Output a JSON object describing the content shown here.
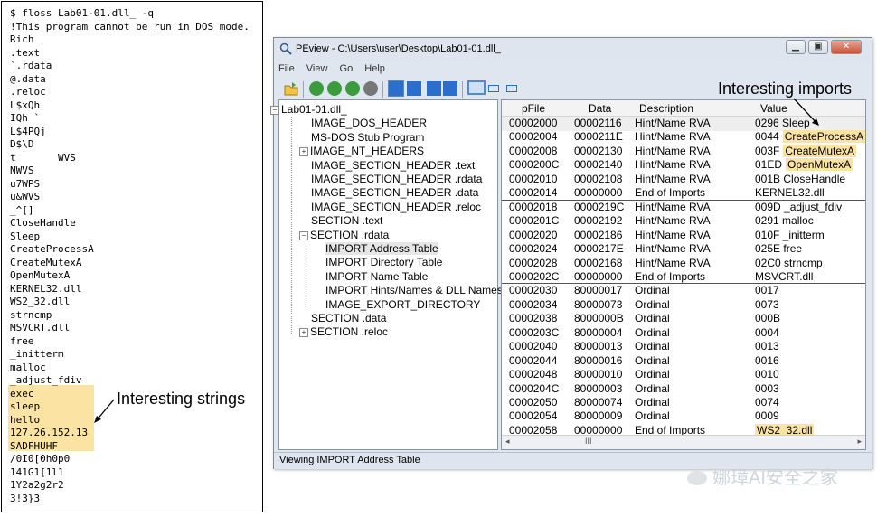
{
  "terminal": {
    "lines": [
      "$ floss Lab01-01.dll_ -q",
      "!This program cannot be run in DOS mode.",
      "Rich",
      ".text",
      "`.rdata",
      "@.data",
      ".reloc",
      "L$xQh",
      "IQh `",
      "L$4PQj",
      "D$\\D",
      "t       WVS",
      "NWVS",
      "u7WPS",
      "u&WVS",
      "_^[]",
      "CloseHandle",
      "Sleep",
      "CreateProcessA",
      "CreateMutexA",
      "OpenMutexA",
      "KERNEL32.dll",
      "WS2_32.dll",
      "strncmp",
      "MSVCRT.dll",
      "free",
      "_initterm",
      "malloc",
      "_adjust_fdiv",
      "exec",
      "sleep",
      "hello",
      "127.26.152.13",
      "SADFHUHF",
      "/0I0[0h0p0",
      "141G1[1l1",
      "1Y2a2g2r2",
      "3!3}3"
    ],
    "annotation": "Interesting strings"
  },
  "window": {
    "title": "PEview - C:\\Users\\user\\Desktop\\Lab01-01.dll_",
    "buttons": {
      "minimize": "▁",
      "maximize": "▣",
      "close": "✕"
    },
    "menu": [
      "File",
      "View",
      "Go",
      "Help"
    ],
    "status": "Viewing IMPORT Address Table",
    "imports_annotation": "Interesting imports",
    "scroll": {
      "left": "◂",
      "thumb": "III",
      "right": "▸"
    }
  },
  "toolbar_icons": [
    "open-icon",
    "back-icon",
    "forward-icon",
    "up-icon",
    "down-icon",
    "next-icon",
    "view1-icon",
    "view2-icon",
    "view3-icon",
    "view4-icon",
    "list-view-icon",
    "hex-view-icon",
    "text-view-icon"
  ],
  "tree": [
    {
      "label": "Lab01-01.dll_",
      "level": 0,
      "expander": "−"
    },
    {
      "label": "IMAGE_DOS_HEADER",
      "level": 1
    },
    {
      "label": "MS-DOS Stub Program",
      "level": 1
    },
    {
      "label": "IMAGE_NT_HEADERS",
      "level": 1,
      "expander": "+"
    },
    {
      "label": "IMAGE_SECTION_HEADER .text",
      "level": 1
    },
    {
      "label": "IMAGE_SECTION_HEADER .rdata",
      "level": 1
    },
    {
      "label": "IMAGE_SECTION_HEADER .data",
      "level": 1
    },
    {
      "label": "IMAGE_SECTION_HEADER .reloc",
      "level": 1
    },
    {
      "label": "SECTION .text",
      "level": 1
    },
    {
      "label": "SECTION .rdata",
      "level": 1,
      "expander": "−"
    },
    {
      "label": "IMPORT Address Table",
      "level": 2,
      "selected": true
    },
    {
      "label": "IMPORT Directory Table",
      "level": 2
    },
    {
      "label": "IMPORT Name Table",
      "level": 2
    },
    {
      "label": "IMPORT Hints/Names & DLL Names",
      "level": 2
    },
    {
      "label": "IMAGE_EXPORT_DIRECTORY",
      "level": 2
    },
    {
      "label": "SECTION .data",
      "level": 1
    },
    {
      "label": "SECTION .reloc",
      "level": 1,
      "expander": "+"
    }
  ],
  "list": {
    "columns": [
      "pFile",
      "Data",
      "Description",
      "Value"
    ],
    "rows": [
      {
        "pfile": "00002000",
        "data": "00002116",
        "desc": "Hint/Name RVA",
        "val": "0296  Sleep"
      },
      {
        "pfile": "00002004",
        "data": "0000211E",
        "desc": "Hint/Name RVA",
        "val": "0044",
        "name": "CreateProcessA",
        "hl": true
      },
      {
        "pfile": "00002008",
        "data": "00002130",
        "desc": "Hint/Name RVA",
        "val": "003F",
        "name": "CreateMutexA",
        "hl": true
      },
      {
        "pfile": "0000200C",
        "data": "00002140",
        "desc": "Hint/Name RVA",
        "val": "01ED",
        "name": "OpenMutexA",
        "hl": true
      },
      {
        "pfile": "00002010",
        "data": "00002108",
        "desc": "Hint/Name RVA",
        "val": "001B  CloseHandle"
      },
      {
        "pfile": "00002014",
        "data": "00000000",
        "desc": "End of Imports",
        "val": "KERNEL32.dll"
      },
      {
        "pfile": "00002018",
        "data": "0000219C",
        "desc": "Hint/Name RVA",
        "val": "009D  _adjust_fdiv"
      },
      {
        "pfile": "0000201C",
        "data": "00002192",
        "desc": "Hint/Name RVA",
        "val": "0291  malloc"
      },
      {
        "pfile": "00002020",
        "data": "00002186",
        "desc": "Hint/Name RVA",
        "val": "010F  _initterm"
      },
      {
        "pfile": "00002024",
        "data": "0000217E",
        "desc": "Hint/Name RVA",
        "val": "025E  free"
      },
      {
        "pfile": "00002028",
        "data": "00002168",
        "desc": "Hint/Name RVA",
        "val": "02C0  strncmp"
      },
      {
        "pfile": "0000202C",
        "data": "00000000",
        "desc": "End of Imports",
        "val": "MSVCRT.dll"
      },
      {
        "pfile": "00002030",
        "data": "80000017",
        "desc": "Ordinal",
        "val": "0017"
      },
      {
        "pfile": "00002034",
        "data": "80000073",
        "desc": "Ordinal",
        "val": "0073"
      },
      {
        "pfile": "00002038",
        "data": "8000000B",
        "desc": "Ordinal",
        "val": "000B"
      },
      {
        "pfile": "0000203C",
        "data": "80000004",
        "desc": "Ordinal",
        "val": "0004"
      },
      {
        "pfile": "00002040",
        "data": "80000013",
        "desc": "Ordinal",
        "val": "0013"
      },
      {
        "pfile": "00002044",
        "data": "80000016",
        "desc": "Ordinal",
        "val": "0016"
      },
      {
        "pfile": "00002048",
        "data": "80000010",
        "desc": "Ordinal",
        "val": "0010"
      },
      {
        "pfile": "0000204C",
        "data": "80000003",
        "desc": "Ordinal",
        "val": "0003"
      },
      {
        "pfile": "00002050",
        "data": "80000074",
        "desc": "Ordinal",
        "val": "0074"
      },
      {
        "pfile": "00002054",
        "data": "80000009",
        "desc": "Ordinal",
        "val": "0009"
      },
      {
        "pfile": "00002058",
        "data": "00000000",
        "desc": "End of Imports",
        "val": "WS2_32.dll",
        "hl": true
      }
    ]
  },
  "watermark": "娜璋AI安全之家",
  "colors": {
    "highlight": "#fbe3a4",
    "selection": "#e6e6e6"
  }
}
